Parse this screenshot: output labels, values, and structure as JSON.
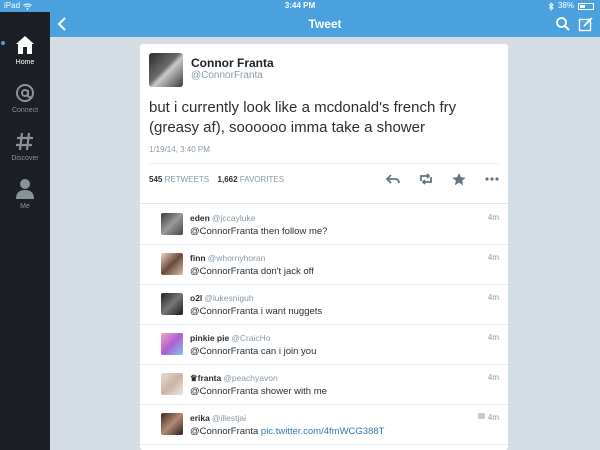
{
  "status_bar": {
    "device": "iPad",
    "time": "3:44 PM",
    "battery": "38%",
    "battery_level": 0.38
  },
  "sidebar": {
    "items": [
      {
        "label": "Home",
        "icon": "home-icon",
        "active": true
      },
      {
        "label": "Connect",
        "icon": "at-icon",
        "active": false
      },
      {
        "label": "Discover",
        "icon": "hashtag-icon",
        "active": false
      },
      {
        "label": "Me",
        "icon": "person-icon",
        "active": false
      }
    ]
  },
  "header": {
    "title": "Tweet"
  },
  "tweet": {
    "author_name": "Connor Franta",
    "author_handle": "@ConnorFranta",
    "text": "but i currently look like a mcdonald's french fry (greasy af), soooooo imma take a shower",
    "timestamp": "1/19/14, 3:40 PM",
    "retweets_count": "545",
    "retweets_label": "RETWEETS",
    "favorites_count": "1,662",
    "favorites_label": "FAVORITES"
  },
  "replies": [
    {
      "name": "eden",
      "handle": "@jccayluke",
      "text": "@ConnorFranta then follow me?",
      "link": "",
      "time": "4m",
      "has_media": false
    },
    {
      "name": "finn",
      "handle": "@whornyhoran",
      "text": "@ConnorFranta don't jack off",
      "link": "",
      "time": "4m",
      "has_media": false
    },
    {
      "name": "o2l",
      "handle": "@lukesniguh",
      "text": "@ConnorFranta i want nuggets",
      "link": "",
      "time": "4m",
      "has_media": false
    },
    {
      "name": "pinkie pie",
      "handle": "@CraicHo",
      "text": "@ConnorFranta can i join you",
      "link": "",
      "time": "4m",
      "has_media": false
    },
    {
      "name": "♛franta",
      "handle": "@peachyavon",
      "text": "@ConnorFranta shower with me",
      "link": "",
      "time": "4m",
      "has_media": false
    },
    {
      "name": "erika",
      "handle": "@illestjai",
      "text": "@ConnorFranta",
      "link": "pic.twitter.com/4fmWCG388T",
      "time": "4m",
      "has_media": true
    }
  ],
  "colors": {
    "accent": "#4ba1de",
    "sidebar_bg": "#1c1f23",
    "content_bg": "#d5dde4",
    "link": "#2b7bb9",
    "muted": "#8899a6"
  }
}
